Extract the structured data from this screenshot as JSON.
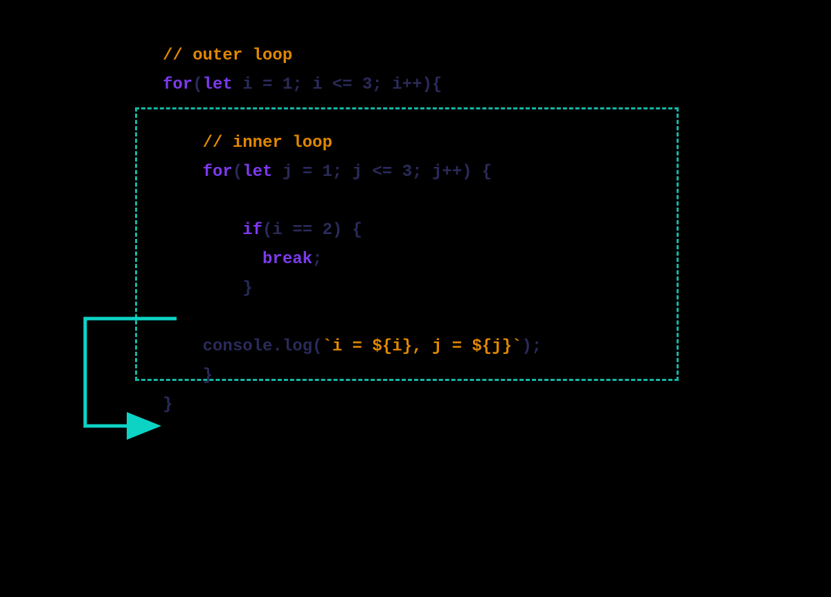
{
  "code": {
    "outer_comment": "// outer loop",
    "outer_for_kw": "for",
    "let1": "let",
    "outer_for_rest_a": " i = ",
    "outer_for_num1": "1",
    "outer_for_rest_b": "; i <= ",
    "outer_for_num2": "3",
    "outer_for_rest_c": "; i++){",
    "inner_comment": "// inner loop",
    "inner_for_kw": "for",
    "let2": "let",
    "inner_for_rest_a": " j = ",
    "inner_for_num1": "1",
    "inner_for_rest_b": "; j <= ",
    "inner_for_num2": "3",
    "inner_for_rest_c": "; j++) {",
    "if_kw": "if",
    "if_rest_a": "(i == ",
    "if_num": "2",
    "if_rest_b": ") {",
    "break_kw": "break",
    "break_semi": ";",
    "close1": "}",
    "console_part_a": "console.log(",
    "console_tmpl_a": "`i = ",
    "console_interp_i": "${i}",
    "console_tmpl_b": ", j = ",
    "console_interp_j": "${j}",
    "console_tmpl_c": "`",
    "console_part_b": ");",
    "close2": "}",
    "close3": "}"
  },
  "colors": {
    "comment": "#e08800",
    "keyword": "#7c3aed",
    "punct": "#2a2a5a",
    "box": "#14b8a6",
    "arrow": "#0dd3c5"
  }
}
